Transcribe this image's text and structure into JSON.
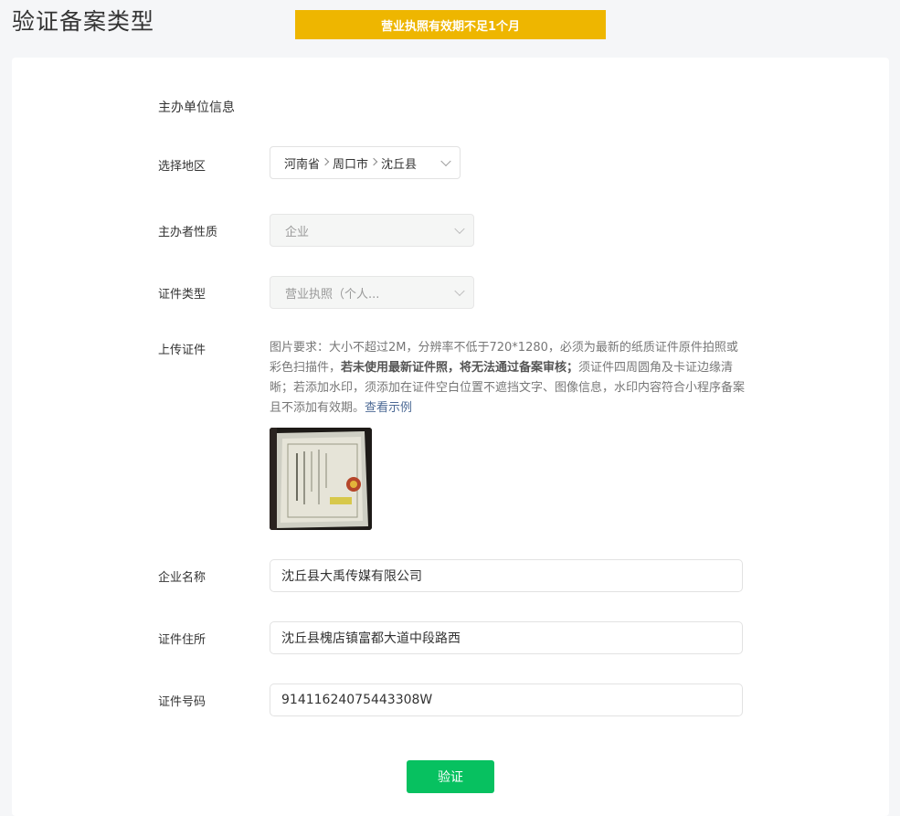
{
  "header": {
    "title": "验证备案类型",
    "warning": "营业执照有效期不足1个月"
  },
  "form": {
    "section_title": "主办单位信息",
    "region": {
      "label": "选择地区",
      "province": "河南省",
      "city": "周口市",
      "county": "沈丘县"
    },
    "organizer_type": {
      "label": "主办者性质",
      "value": "企业"
    },
    "certificate_type": {
      "label": "证件类型",
      "value": "营业执照（个人..."
    },
    "upload": {
      "label": "上传证件",
      "desc_part1": "图片要求：大小不超过2M，分辨率不低于720*1280，必须为最新的纸质证件原件拍照或彩色扫描件，",
      "desc_bold": "若未使用最新证件照，将无法通过备案审核；",
      "desc_part2": "须证件四周圆角及卡证边缘清晰；若添加水印，须添加在证件空白位置不遮挡文字、图像信息，水印内容符合小程序备案且不添加有效期。",
      "example_link": "查看示例"
    },
    "company_name": {
      "label": "企业名称",
      "value": "沈丘县大禹传媒有限公司"
    },
    "address": {
      "label": "证件住所",
      "value": "沈丘县槐店镇富都大道中段路西"
    },
    "cert_number": {
      "label": "证件号码",
      "value": "91411624075443308W"
    },
    "submit_label": "验证"
  }
}
